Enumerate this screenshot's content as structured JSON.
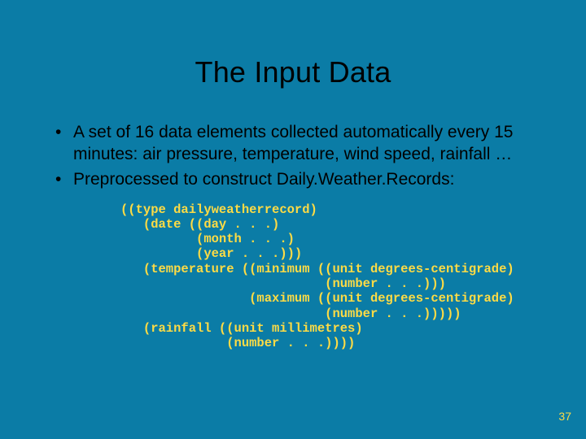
{
  "title": "The Input Data",
  "bullets": [
    "A set of 16 data elements collected automatically every 15 minutes:  air pressure, temperature, wind speed, rainfall …",
    "Preprocessed to construct Daily.Weather.Records:"
  ],
  "code": "((type dailyweatherrecord)\n   (date ((day . . .)\n          (month . . .)\n          (year . . .)))\n   (temperature ((minimum ((unit degrees-centigrade)\n                           (number . . .)))\n                 (maximum ((unit degrees-centigrade)\n                           (number . . .)))))\n   (rainfall ((unit millimetres)\n              (number . . .))))",
  "page_number": "37"
}
